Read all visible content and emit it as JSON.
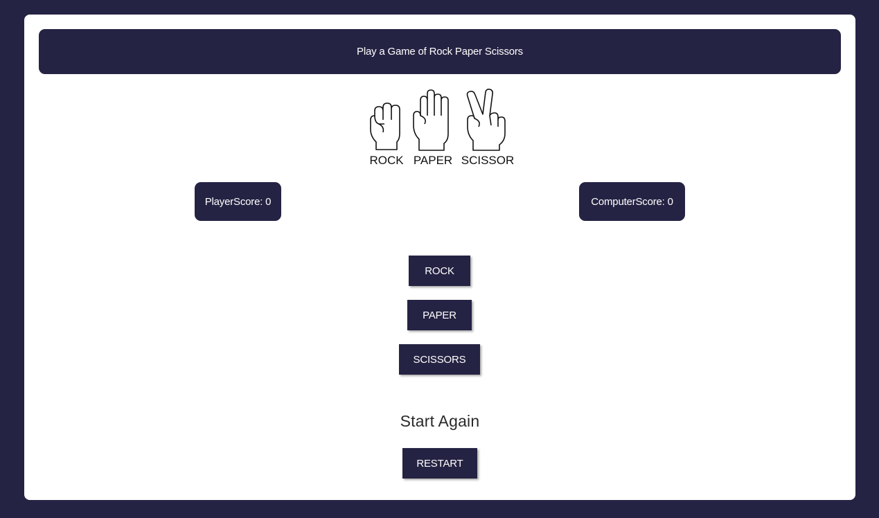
{
  "header": {
    "title": "Play a Game of Rock Paper Scissors"
  },
  "logo": {
    "labels": [
      "ROCK",
      "PAPER",
      "SCISSOR"
    ]
  },
  "scores": {
    "player_label": "PlayerScore: 0",
    "computer_label": "ComputerScore: 0"
  },
  "choices": {
    "rock_label": "ROCK",
    "paper_label": "PAPER",
    "scissors_label": "SCISSORS"
  },
  "restart": {
    "heading": "Start Again",
    "button_label": "RESTART"
  },
  "colors": {
    "background": "#252343",
    "card": "#ffffff",
    "accent": "#252343"
  }
}
